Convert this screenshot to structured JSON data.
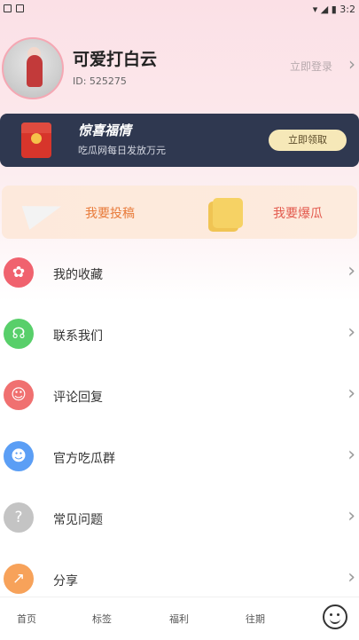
{
  "status_bar": {
    "left_icons": [
      "square-icon",
      "square-icon"
    ],
    "time": "3:2"
  },
  "profile": {
    "name": "可爱打白云",
    "id_text": "ID: 525275",
    "signin_label": "立即登录"
  },
  "banner": {
    "title": "惊喜福情",
    "subtitle": "吃瓜网每日发放万元",
    "button_label": "立即领取"
  },
  "actions": {
    "submit_label": "我要投稿",
    "tip_label": "我要爆瓜"
  },
  "menu": [
    {
      "label": "我的收藏",
      "icon": "star-icon",
      "color": "#f0626e"
    },
    {
      "label": "联系我们",
      "icon": "headset-icon",
      "color": "#58cf6a"
    },
    {
      "label": "评论回复",
      "icon": "chat-icon",
      "color": "#f07070"
    },
    {
      "label": "官方吃瓜群",
      "icon": "group-icon",
      "color": "#5b9ef5"
    },
    {
      "label": "常见问题",
      "icon": "help-icon",
      "color": "#c4c4c4"
    },
    {
      "label": "分享",
      "icon": "share-icon",
      "color": "#f7a25a"
    }
  ],
  "tabbar": [
    {
      "label": "首页"
    },
    {
      "label": "标签"
    },
    {
      "label": "福利"
    },
    {
      "label": "往期"
    }
  ],
  "colors": {
    "banner_bg": "#2f3850",
    "accent_orange": "#e87b3a",
    "accent_red": "#e35a4e"
  }
}
